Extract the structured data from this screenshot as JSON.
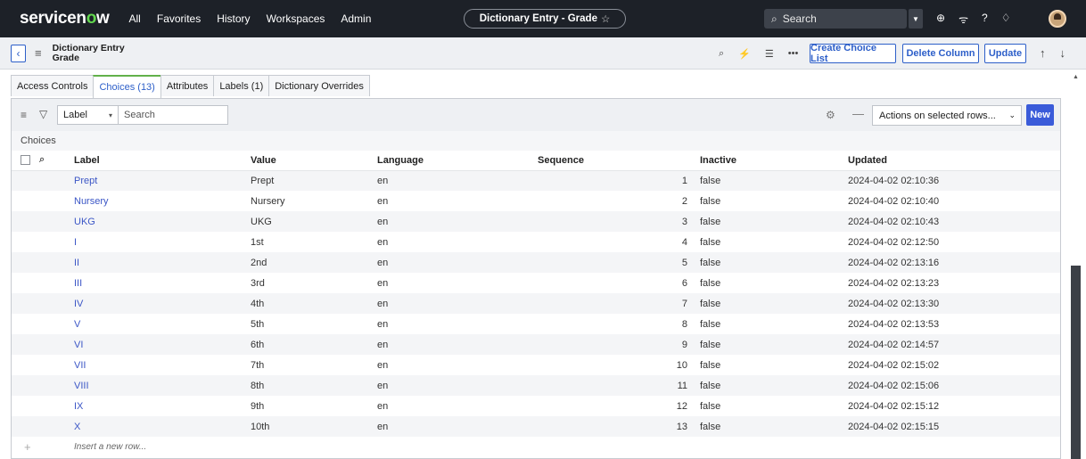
{
  "header": {
    "logo_pre": "servicen",
    "logo_o": "o",
    "logo_post": "w",
    "nav": [
      "All",
      "Favorites",
      "History",
      "Workspaces",
      "Admin"
    ],
    "record_title": "Dictionary Entry - Grade",
    "search_label": "Search"
  },
  "form": {
    "title_line1": "Dictionary Entry",
    "title_line2": "Grade",
    "buttons": {
      "create_choice_list": "Create Choice List",
      "delete_column": "Delete Column",
      "update": "Update"
    }
  },
  "tabs": [
    {
      "label": "Access Controls"
    },
    {
      "label": "Choices (13)"
    },
    {
      "label": "Attributes"
    },
    {
      "label": "Labels (1)"
    },
    {
      "label": "Dictionary Overrides"
    }
  ],
  "list": {
    "field_select": "Label",
    "search_placeholder": "Search",
    "actions_select": "Actions on selected rows...",
    "new_label": "New",
    "caption": "Choices",
    "columns": [
      "Label",
      "Value",
      "Language",
      "Sequence",
      "Inactive",
      "Updated"
    ],
    "rows": [
      {
        "label": "Prept",
        "value": "Prept",
        "language": "en",
        "sequence": "1",
        "inactive": "false",
        "updated": "2024-04-02 02:10:36"
      },
      {
        "label": "Nursery",
        "value": "Nursery",
        "language": "en",
        "sequence": "2",
        "inactive": "false",
        "updated": "2024-04-02 02:10:40"
      },
      {
        "label": "UKG",
        "value": "UKG",
        "language": "en",
        "sequence": "3",
        "inactive": "false",
        "updated": "2024-04-02 02:10:43"
      },
      {
        "label": "I",
        "value": "1st",
        "language": "en",
        "sequence": "4",
        "inactive": "false",
        "updated": "2024-04-02 02:12:50"
      },
      {
        "label": "II",
        "value": "2nd",
        "language": "en",
        "sequence": "5",
        "inactive": "false",
        "updated": "2024-04-02 02:13:16"
      },
      {
        "label": "III",
        "value": "3rd",
        "language": "en",
        "sequence": "6",
        "inactive": "false",
        "updated": "2024-04-02 02:13:23"
      },
      {
        "label": "IV",
        "value": "4th",
        "language": "en",
        "sequence": "7",
        "inactive": "false",
        "updated": "2024-04-02 02:13:30"
      },
      {
        "label": "V",
        "value": "5th",
        "language": "en",
        "sequence": "8",
        "inactive": "false",
        "updated": "2024-04-02 02:13:53"
      },
      {
        "label": "VI",
        "value": "6th",
        "language": "en",
        "sequence": "9",
        "inactive": "false",
        "updated": "2024-04-02 02:14:57"
      },
      {
        "label": "VII",
        "value": "7th",
        "language": "en",
        "sequence": "10",
        "inactive": "false",
        "updated": "2024-04-02 02:15:02"
      },
      {
        "label": "VIII",
        "value": "8th",
        "language": "en",
        "sequence": "11",
        "inactive": "false",
        "updated": "2024-04-02 02:15:06"
      },
      {
        "label": "IX",
        "value": "9th",
        "language": "en",
        "sequence": "12",
        "inactive": "false",
        "updated": "2024-04-02 02:15:12"
      },
      {
        "label": "X",
        "value": "10th",
        "language": "en",
        "sequence": "13",
        "inactive": "false",
        "updated": "2024-04-02 02:15:15"
      }
    ],
    "insert_row": "Insert a new row..."
  },
  "colors": {
    "accent": "#3a5bd9",
    "topbar": "#1d2128",
    "active_tab": "#62b14a"
  }
}
